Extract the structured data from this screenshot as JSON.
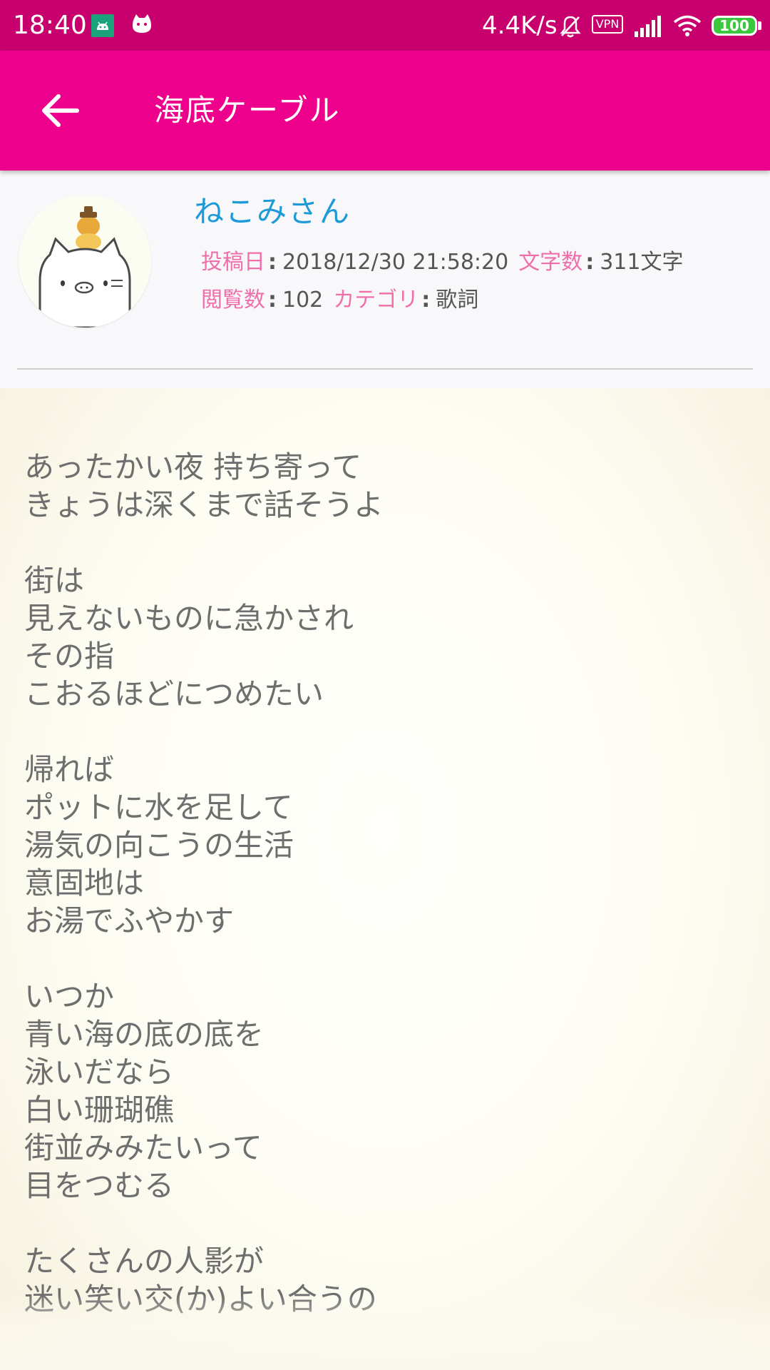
{
  "status_bar": {
    "time": "18:40",
    "network_speed": "4.4K/s",
    "vpn_label": "VPN",
    "battery": "100",
    "icons": [
      "android-debug-icon",
      "cat-app-icon",
      "bell-muted-icon",
      "vpn-icon",
      "signal-icon",
      "wifi-icon",
      "battery-icon"
    ]
  },
  "app_bar": {
    "back_icon": "arrow-left-icon",
    "title": "海底ケーブル"
  },
  "header": {
    "author": "ねこみさん",
    "avatar_icon": "cat-avatar",
    "meta": {
      "posted_label": "投稿日",
      "posted_value": "2018/12/30 21:58:20",
      "chars_label": "文字数",
      "chars_value": "311文字",
      "views_label": "閲覧数",
      "views_value": "102",
      "category_label": "カテゴリ",
      "category_value": "歌詞",
      "separator": ":"
    }
  },
  "body": {
    "lines": [
      "あったかい夜 持ち寄って",
      "きょうは深くまで話そうよ",
      "",
      "街は",
      "見えないものに急かされ",
      "その指",
      "こおるほどにつめたい",
      "",
      "帰れば",
      "ポットに水を足して",
      "湯気の向こうの生活",
      "意固地は",
      "お湯でふやかす",
      "",
      "いつか",
      "青い海の底の底を",
      "泳いだなら",
      "白い珊瑚礁",
      "街並みみたいって",
      "目をつむる",
      "",
      "たくさんの人影が",
      "迷い笑い交(か)よい合うの"
    ]
  },
  "colors": {
    "status_bar": "#c8006e",
    "app_bar": "#ec008c",
    "author": "#1e9bd7",
    "meta_label": "#f06eaa",
    "text": "#6e6e6e"
  }
}
